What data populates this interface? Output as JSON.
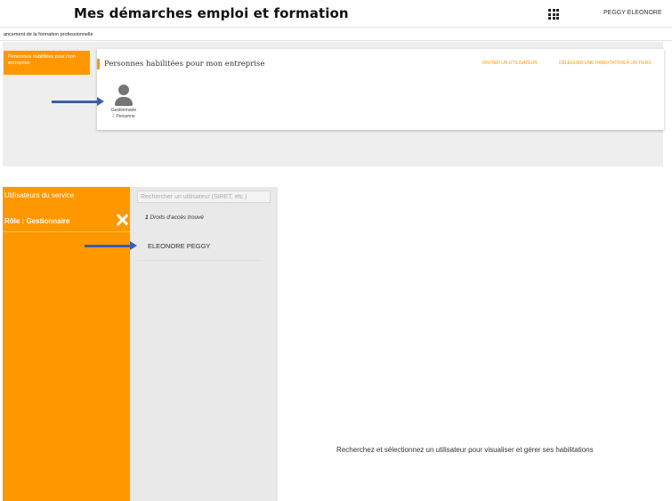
{
  "header": {
    "app_title": "Mes démarches emploi et formation",
    "apps_icon": "grid-apps-icon",
    "user_name": "PEGGY ELEONORE",
    "subtitle": "ancement de la formation professionnelle"
  },
  "left_menu": {
    "items": [
      {
        "label": "Personnes habilitées pour mon entreprise",
        "active": true
      }
    ]
  },
  "card": {
    "title": "Personnes habilitées pour mon entreprise",
    "actions": {
      "invite": "INVITER UN UTILISATEUR",
      "delegate": "DÉLÉGUER UNE HABILITATION À UN TIERS"
    },
    "role": {
      "icon": "person-icon",
      "label": "Gestionnaire",
      "count": "1",
      "count_unit": "Personne"
    }
  },
  "service_panel": {
    "heading": "Utilisateurs du service",
    "role_label": "Rôle : Gestionnaire",
    "close_icon": "close-icon"
  },
  "search": {
    "placeholder": "Rechercher un utilisateur (SIRET, etc.)",
    "value": ""
  },
  "results": {
    "count": "1",
    "label": "Droits d'accès trouvé",
    "items": [
      {
        "name": "ELEONORE PEGGY"
      }
    ]
  },
  "detail": {
    "empty_message": "Recherchez et sélectionnez un utilisateur pour visualiser et gérer ses habilitations"
  },
  "colors": {
    "accent": "#ff9800",
    "arrow": "#3a5fa8",
    "panel_bg": "#eeeeee",
    "list_bg": "#e9e9e9"
  }
}
